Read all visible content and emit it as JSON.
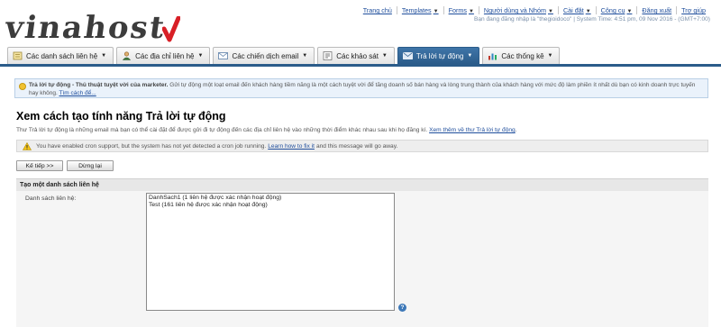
{
  "brand": {
    "logo_text": "vinahost",
    "accent": "#d81f26"
  },
  "topnav": {
    "items": [
      {
        "label": "Trang chủ",
        "caret": false
      },
      {
        "label": "Templates",
        "caret": true
      },
      {
        "label": "Forms",
        "caret": true
      },
      {
        "label": "Người dùng và Nhóm",
        "caret": true
      },
      {
        "label": "Cài đặt",
        "caret": true
      },
      {
        "label": "Công cụ",
        "caret": true
      },
      {
        "label": "Đăng xuất",
        "caret": false
      },
      {
        "label": "Trợ giúp",
        "caret": false
      }
    ],
    "login_info": "Bạn đang đăng nhập là \"thegioidoco\" | System Time: 4:51 pm, 09 Nov 2016 - (GMT+7:00)"
  },
  "tabs": [
    {
      "label": "Các danh sách liên hệ",
      "icon": "contact-list-icon",
      "active": false
    },
    {
      "label": "Các địa chỉ liên hệ",
      "icon": "contacts-icon",
      "active": false
    },
    {
      "label": "Các chiến dịch email",
      "icon": "email-campaign-icon",
      "active": false
    },
    {
      "label": "Các khảo sát",
      "icon": "survey-icon",
      "active": false
    },
    {
      "label": "Trả lời tự động",
      "icon": "autoresponder-icon",
      "active": true
    },
    {
      "label": "Các thống kê",
      "icon": "stats-icon",
      "active": false
    }
  ],
  "info": {
    "title": "Trả lời tự động - Thủ thuật tuyệt vời của marketer.",
    "body": "Gửi tự động một loạt email đến khách hàng tiềm năng là một cách tuyệt vời để tăng doanh số bán hàng và lòng trung thành của khách hàng với mức độ làm phiền ít nhất dù bạn có kinh doanh trực tuyến hay không.",
    "link": "Tìm cách để..."
  },
  "page": {
    "title": "Xem cách tạo tính năng Trả lời tự động",
    "description": "Thư Trả lời tự động là những email mà bạn có thể cài đặt để được gửi đi tự động đến các địa chỉ liên hệ vào những thời điểm khác nhau sau khi họ đăng kí.",
    "description_link": "Xem thêm về thư Trả lời tự động",
    "description_end": "."
  },
  "warning": {
    "text_before": "You have enabled cron support, but the system has not yet detected a cron job running.",
    "link": "Learn how to fix it",
    "text_after": "and this message will go away."
  },
  "buttons": {
    "next": "Kế tiếp >>",
    "stop": "Dừng lại"
  },
  "section": {
    "title": "Tạo một danh sách liên hệ",
    "field_label": "Danh sách liên hệ:",
    "options": [
      "DanhSach1 (1 liên hệ được xác nhận hoạt động)",
      "Test (161 liên hệ được xác nhận hoạt động)"
    ]
  }
}
